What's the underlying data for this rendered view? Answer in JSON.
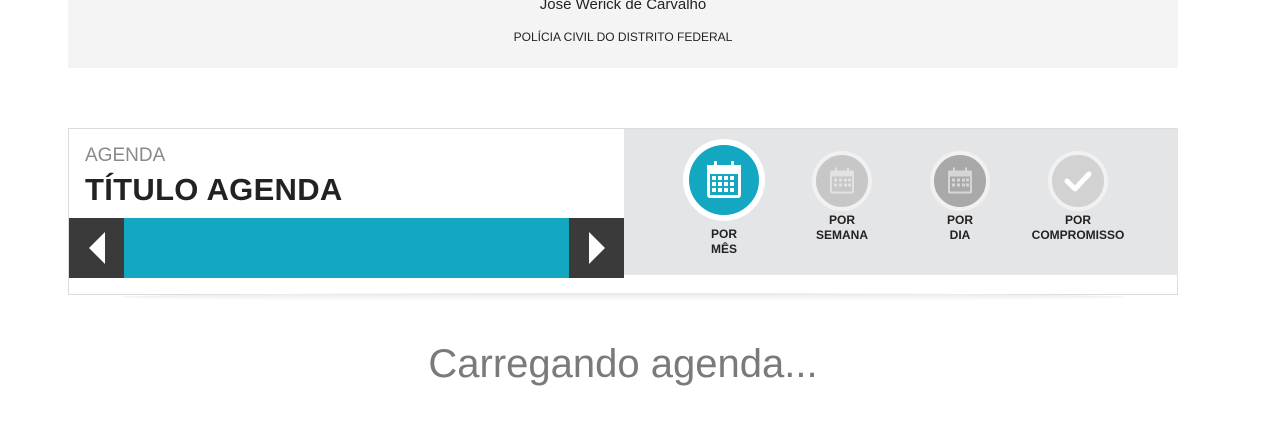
{
  "header": {
    "user_name": "José Werick de Carvalho",
    "organization": "POLÍCIA CIVIL DO DISTRITO FEDERAL"
  },
  "agenda": {
    "label": "AGENDA",
    "title": "TÍTULO AGENDA",
    "prev_icon": "chevron-left-icon",
    "next_icon": "chevron-right-icon",
    "accent_color": "#14a7c1"
  },
  "views": [
    {
      "line1": "POR",
      "line2": "MÊS",
      "icon": "calendar-icon",
      "active": true
    },
    {
      "line1": "POR",
      "line2": "SEMANA",
      "icon": "calendar-icon",
      "active": false
    },
    {
      "line1": "POR",
      "line2": "DIA",
      "icon": "calendar-icon",
      "active": false
    },
    {
      "line1": "POR",
      "line2": "COMPROMISSO",
      "icon": "check-icon",
      "active": false
    }
  ],
  "status": {
    "loading_text": "Carregando agenda..."
  }
}
